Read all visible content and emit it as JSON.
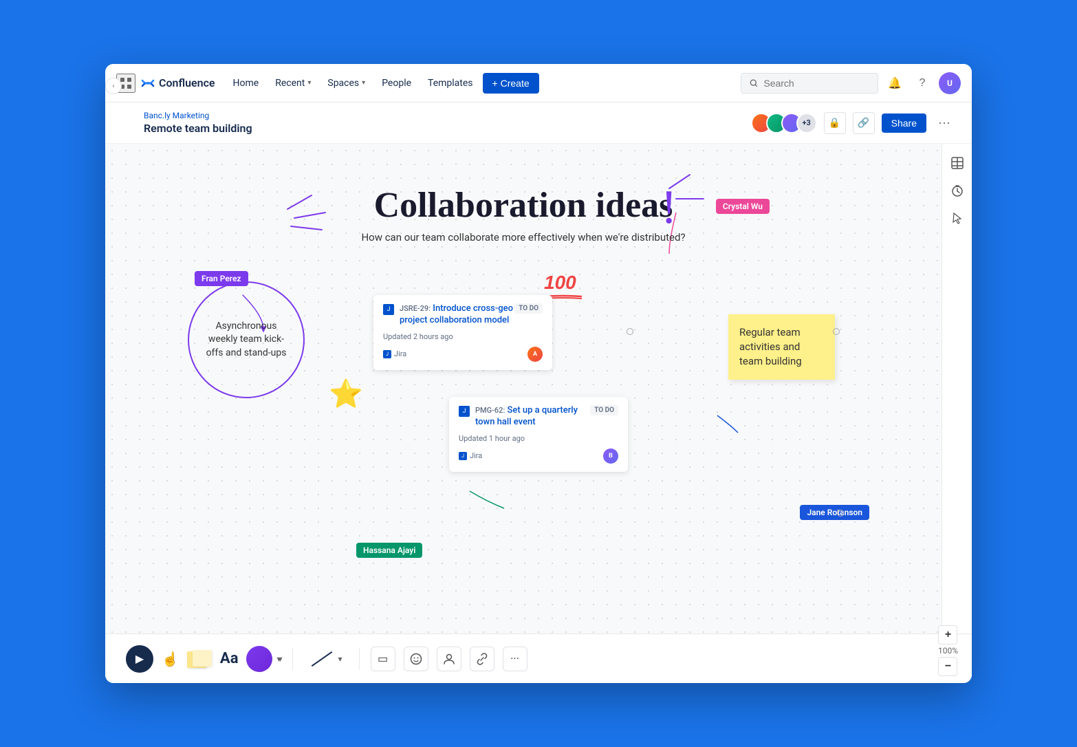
{
  "app": {
    "name": "Confluence",
    "logo_icon": "✕"
  },
  "topnav": {
    "home_label": "Home",
    "recent_label": "Recent",
    "spaces_label": "Spaces",
    "people_label": "People",
    "templates_label": "Templates",
    "create_label": "+ Create",
    "search_placeholder": "Search"
  },
  "breadcrumb": {
    "parent": "Banc.ly Marketing",
    "current": "Remote team building"
  },
  "page_actions": {
    "share_label": "Share",
    "avatar_count": "+3"
  },
  "canvas": {
    "title": "Collaboration ideas",
    "subtitle": "How can our team collaborate more effectively when we're distributed?",
    "note_circle_text": "Asynchronous weekly team kick-offs and stand-ups",
    "sticky_yellow_text": "Regular team activities and team building",
    "jira_card1": {
      "id": "JSRE-29",
      "title": "Introduce cross-geo project collaboration model",
      "status": "TO DO",
      "updated": "Updated 2 hours ago",
      "source": "Jira"
    },
    "jira_card2": {
      "id": "PMG-62",
      "title": "Set up a quarterly town hall event",
      "status": "TO DO",
      "updated": "Updated 1 hour ago",
      "source": "Jira"
    },
    "labels": {
      "crystal_wu": "Crystal Wu",
      "fran_perez": "Fran Perez",
      "jane_rotanson": "Jane Rotanson",
      "hassana_ajayi": "Hassana Ajayi"
    }
  },
  "zoom": {
    "level": "100%",
    "plus": "+",
    "minus": "−"
  },
  "right_toolbar": {
    "table_icon": "⊞",
    "timer_icon": "⏱",
    "pointer_icon": "✈"
  }
}
